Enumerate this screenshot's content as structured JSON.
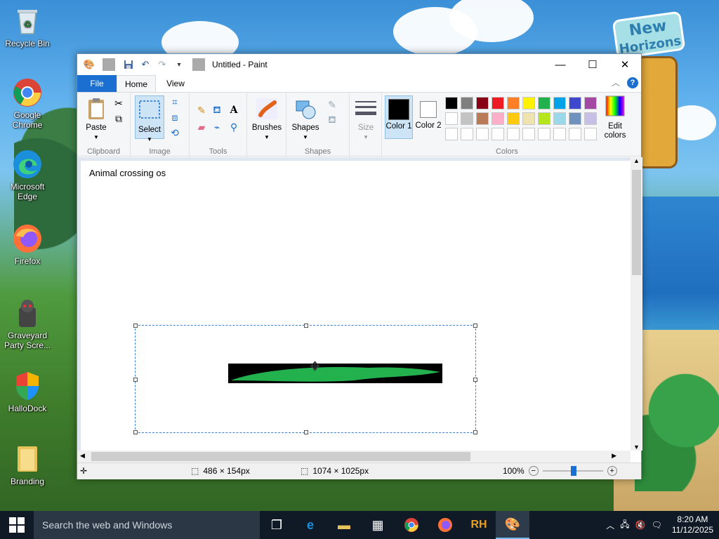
{
  "desktop": {
    "icons": [
      {
        "label": "Recycle Bin"
      },
      {
        "label": "Google Chrome"
      },
      {
        "label": "Microsoft Edge"
      },
      {
        "label": "Firefox"
      },
      {
        "label": "Graveyard Party Scre..."
      },
      {
        "label": "HalloDock"
      },
      {
        "label": "Branding"
      }
    ],
    "wallpaper_logo": {
      "line1": "New",
      "line2": "Horizons"
    }
  },
  "window": {
    "title": "Untitled - Paint",
    "tabs": [
      "File",
      "Home",
      "View"
    ],
    "ribbon": {
      "clipboard": {
        "paste": "Paste",
        "group": "Clipboard"
      },
      "image": {
        "select": "Select",
        "group": "Image"
      },
      "tools": {
        "group": "Tools"
      },
      "brushes": {
        "label": "Brushes"
      },
      "shapes": {
        "label": "Shapes",
        "group": "Shapes"
      },
      "size": {
        "label": "Size"
      },
      "colors": {
        "color1": "Color 1",
        "color2": "Color 2",
        "edit": "Edit colors",
        "group": "Colors",
        "row1": [
          "#000000",
          "#7f7f7f",
          "#880015",
          "#ed1c24",
          "#ff7f27",
          "#fff200",
          "#22b14c",
          "#00a2e8",
          "#3f48cc",
          "#a349a4"
        ],
        "row2": [
          "#ffffff",
          "#c3c3c3",
          "#b97a57",
          "#ffaec9",
          "#ffc90e",
          "#efe4b0",
          "#b5e61d",
          "#99d9ea",
          "#7092be",
          "#c8bfe7"
        ],
        "row3": [
          "#ffffff",
          "#ffffff",
          "#ffffff",
          "#ffffff",
          "#ffffff",
          "#ffffff",
          "#ffffff",
          "#ffffff",
          "#ffffff",
          "#ffffff"
        ],
        "primary": "#000000",
        "secondary": "#ffffff"
      }
    },
    "canvas": {
      "text": "Animal crossing os",
      "stroke_color": "#22b14c"
    },
    "status": {
      "selection_size": "486 × 154px",
      "image_size": "1074 × 1025px",
      "zoom": "100%"
    }
  },
  "taskbar": {
    "search_placeholder": "Search the web and Windows",
    "apps": [
      "task-view",
      "edge",
      "file-explorer",
      "store",
      "chrome",
      "firefox",
      "rh",
      "paint"
    ],
    "rh_label": "RH",
    "time": "8:20 AM",
    "date": "11/12/2025"
  }
}
